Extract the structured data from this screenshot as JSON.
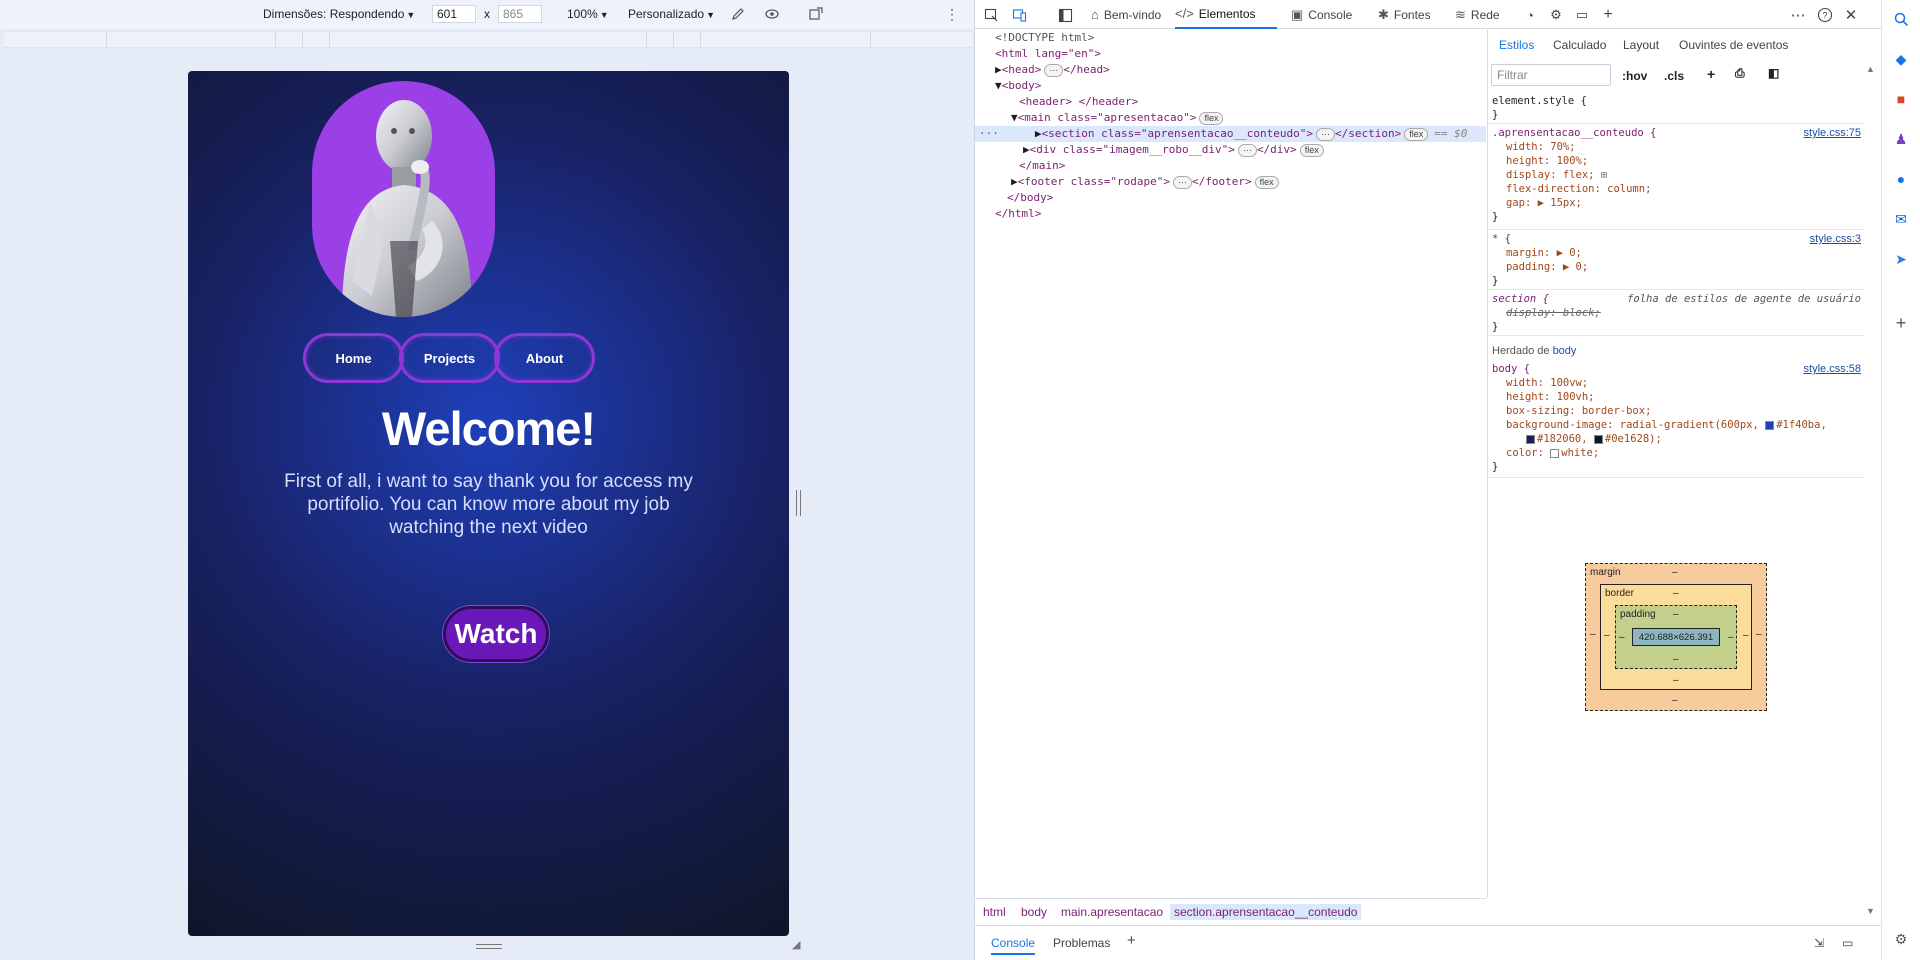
{
  "device_toolbar": {
    "dimensions_label": "Dimensões: Respondendo",
    "width": "601",
    "times": "x",
    "height": "865",
    "zoom": "100%",
    "throttle": "Personalizado"
  },
  "site": {
    "nav": [
      "Home",
      "Projects",
      "About"
    ],
    "welcome": "Welcome!",
    "intro": "First of all, i want to say thank you for access my portifolio. You can know more about my job watching the next video",
    "watch": "Watch"
  },
  "devtools": {
    "tabs": [
      "Bem-vindo",
      "Elementos",
      "Console",
      "Fontes",
      "Rede"
    ],
    "elements": {
      "doctype": "<!DOCTYPE html>",
      "lines": [
        "<html lang=\"en\">",
        "<head>",
        "</head>",
        "<body>",
        "<header> </header>",
        "<main class=\"apresentacao\">",
        "<section class=\"aprensentacao__conteudo\">",
        "</section>",
        "<div class=\"imagem__robo__div\">",
        "</div>",
        "</main>",
        "<footer class=\"rodape\">",
        "</footer>",
        "</body>",
        "</html>"
      ],
      "flex": "flex",
      "ellipsis": "···",
      "selected_marker": "== $0"
    },
    "breadcrumb": [
      "html",
      "body",
      "main.apresentacao",
      "section.aprensentacao__conteudo"
    ],
    "drawer_tabs": [
      "Console",
      "Problemas"
    ],
    "styles": {
      "tabs": [
        "Estilos",
        "Calculado",
        "Layout",
        "Ouvintes de eventos"
      ],
      "filter_placeholder": "Filtrar",
      "hov": ":hov",
      "cls": ".cls",
      "element_style": "element.style {",
      "rule1_selector": ".aprensentacao__conteudo {",
      "rule1_source": "style.css:75",
      "rule1_props": [
        "width: 70%;",
        "height: 100%;",
        "display: flex;",
        "flex-direction: column;",
        "gap: ▶ 15px;"
      ],
      "rule2_selector": "* {",
      "rule2_source": "style.css:3",
      "rule2_props": [
        "margin: ▶ 0;",
        "padding: ▶ 0;"
      ],
      "rule3_selector": "section {",
      "rule3_source": "folha de estilos de agente de usuário",
      "rule3_props": [
        "display: block;"
      ],
      "inherited_label": "Herdado de",
      "inherited_from": "body",
      "rule4_selector": "body {",
      "rule4_source": "style.css:58",
      "rule4_props": [
        "width: 100vw;",
        "height: 100vh;",
        "box-sizing: border-box;"
      ],
      "rule4_bg": "background-image: radial-gradient(600px,",
      "rule4_c1": "#1f40ba,",
      "rule4_c2": "#182060,",
      "rule4_c3": "#0e1628);",
      "rule4_color": "color:",
      "rule4_color_val": "white;",
      "close_brace": "}",
      "colors": [
        "#1f40ba",
        "#182060",
        "#0e1628",
        "#ffffff"
      ]
    },
    "box_model": {
      "margin": "margin",
      "border": "border",
      "padding": "padding",
      "content": "420.688×626.391",
      "dash": "–"
    }
  },
  "icons": [
    "inspect-icon",
    "device-toolbar-icon",
    "dock-icon",
    "home-icon",
    "elements-icon",
    "console-icon",
    "sources-icon",
    "network-icon",
    "performance-icon",
    "settings-gear-icon",
    "application-icon",
    "add-tab-icon",
    "more-icon",
    "help-icon",
    "close-icon",
    "search-icon"
  ]
}
